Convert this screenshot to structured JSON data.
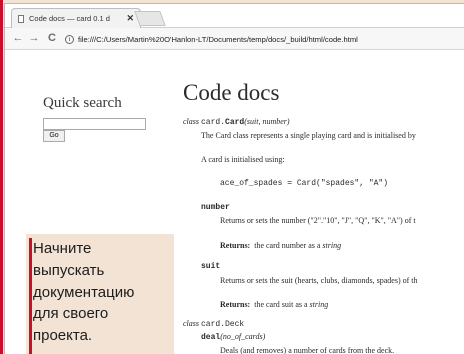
{
  "browser": {
    "tab_title": "Code docs — card 0.1 d",
    "tab_close": "✕",
    "nav": {
      "back": "←",
      "forward": "→",
      "reload": "C"
    },
    "url_info": "i",
    "url": "file:///C:/Users/Martin%20O'Hanlon-LT/Documents/temp/docs/_build/html/code.html"
  },
  "sidebar": {
    "quick_search_title": "Quick search",
    "search_value": "",
    "go_label": "Go"
  },
  "doc": {
    "title": "Code docs",
    "class1": {
      "keyword": "class",
      "name_prefix": "card.",
      "name": "Card",
      "sig": "(suit, number)",
      "desc": "The Card class represents a single playing card and is initialised by",
      "init_text": "A card is initialised using:",
      "code_example": "ace_of_spades = Card(\"spades\", \"A\")",
      "attr1_name": "number",
      "attr1_desc": "Returns or sets the number (\"2\".\"10\", \"J\", \"Q\", \"K\", \"A\") of t",
      "attr1_returns_label": "Returns:",
      "attr1_returns_text": "the card number as a",
      "attr1_returns_type": "string",
      "attr2_name": "suit",
      "attr2_desc": "Returns or sets the suit (hearts, clubs, diamonds, spades) of th",
      "attr2_returns_label": "Returns:",
      "attr2_returns_text": "the card suit as a",
      "attr2_returns_type": "string"
    },
    "class2": {
      "keyword": "class",
      "name": "card.Deck",
      "method_name": "deal",
      "method_sig": "(no_of_cards)",
      "method_desc": "Deals (and removes) a number of cards from the deck."
    }
  },
  "callout": {
    "lines": [
      "Начните",
      "выпускать",
      "документацию",
      "для своего",
      "проекта."
    ]
  },
  "colors": {
    "accent": "#c8102e",
    "page_bg": "#f3e3d4"
  }
}
